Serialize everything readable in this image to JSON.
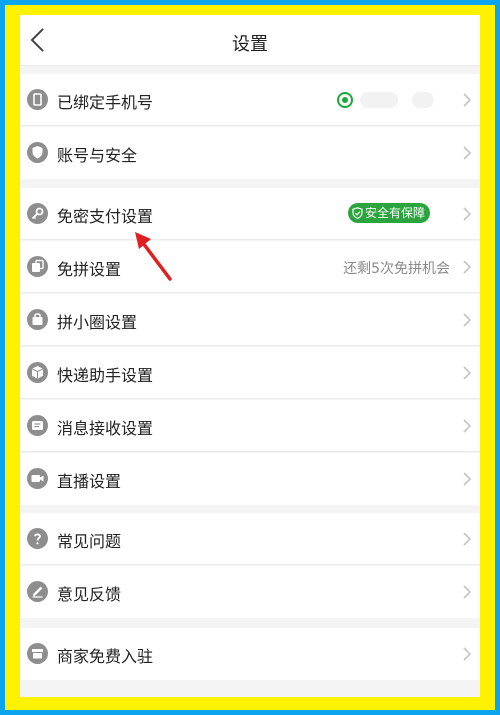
{
  "header": {
    "title": "设置"
  },
  "rows": [
    {
      "id": "phone",
      "label": "已绑定手机号"
    },
    {
      "id": "security",
      "label": "账号与安全"
    },
    {
      "id": "pay",
      "label": "免密支付设置",
      "badge": "安全有保障"
    },
    {
      "id": "pin",
      "label": "免拼设置",
      "value": "还剩5次免拼机会"
    },
    {
      "id": "circle",
      "label": "拼小圈设置"
    },
    {
      "id": "express",
      "label": "快递助手设置"
    },
    {
      "id": "msg",
      "label": "消息接收设置"
    },
    {
      "id": "live",
      "label": "直播设置"
    },
    {
      "id": "faq",
      "label": "常见问题"
    },
    {
      "id": "feedback",
      "label": "意见反馈"
    },
    {
      "id": "merchant",
      "label": "商家免费入驻"
    }
  ],
  "colors": {
    "accent_green": "#2aa53d",
    "icon_gray": "#8e8e8e",
    "arrow_red": "#e02020",
    "frame_yellow": "#fff200",
    "frame_blue": "#0aa5ee"
  }
}
